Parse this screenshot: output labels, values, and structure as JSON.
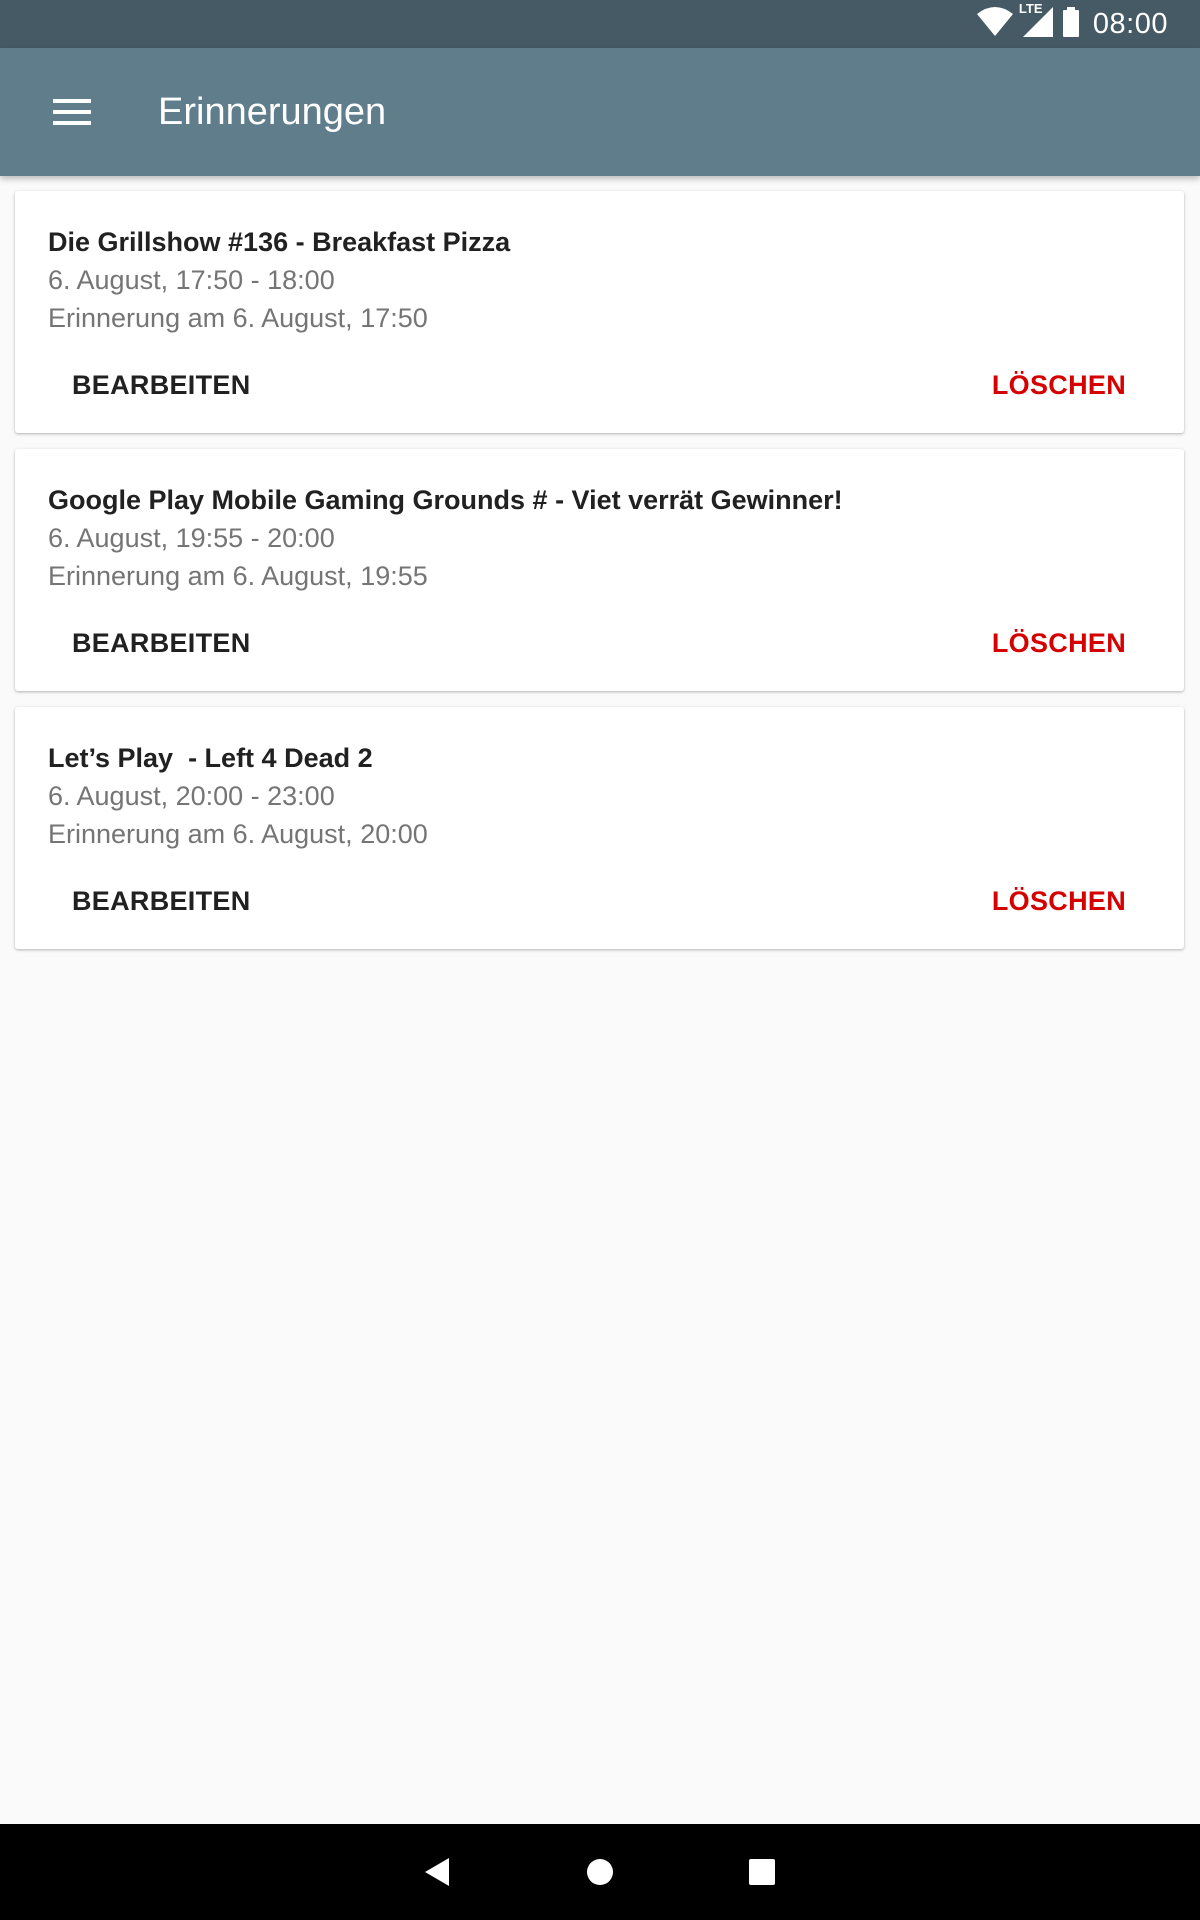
{
  "status_bar": {
    "time": "08:00",
    "network_label": "LTE",
    "icons": [
      "wifi-icon",
      "signal-icon",
      "battery-icon"
    ]
  },
  "app_bar": {
    "title": "Erinnerungen",
    "menu_icon": "hamburger-menu-icon"
  },
  "reminders": [
    {
      "title": "Die Grillshow #136 - Breakfast Pizza",
      "time": "6. August, 17:50 - 18:00",
      "reminder": "Erinnerung am 6. August, 17:50",
      "edit_label": "BEARBEITEN",
      "delete_label": "LÖSCHEN"
    },
    {
      "title": "Google Play Mobile Gaming Grounds # - Viet verrät Gewinner!",
      "time": "6. August, 19:55 - 20:00",
      "reminder": "Erinnerung am 6. August, 19:55",
      "edit_label": "BEARBEITEN",
      "delete_label": "LÖSCHEN"
    },
    {
      "title": "Let’s Play  - Left 4 Dead 2",
      "time": "6. August, 20:00 - 23:00",
      "reminder": "Erinnerung am 6. August, 20:00",
      "edit_label": "BEARBEITEN",
      "delete_label": "LÖSCHEN"
    }
  ],
  "nav_bar": {
    "icons": [
      "back-icon",
      "home-icon",
      "recents-icon"
    ]
  },
  "colors": {
    "status_bar": "#455a64",
    "app_bar": "#607d8b",
    "delete_accent": "#d50000",
    "background": "#fafafa"
  }
}
